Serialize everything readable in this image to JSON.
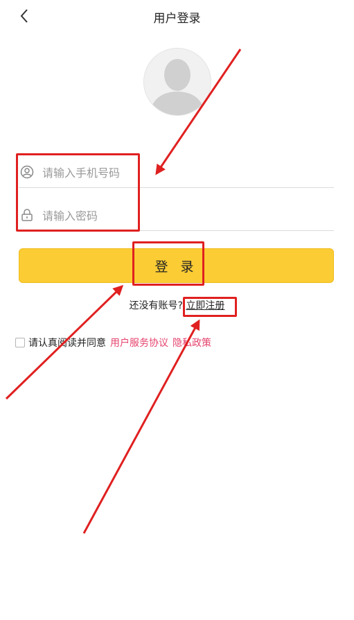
{
  "header": {
    "title": "用户登录",
    "back_icon": "chevron-left-icon"
  },
  "avatar": {
    "icon": "user-silhouette-icon"
  },
  "form": {
    "phone_placeholder": "请输入手机号码",
    "phone_value": "",
    "phone_icon": "user-circle-icon",
    "password_placeholder": "请输入密码",
    "password_value": "",
    "password_icon": "lock-icon"
  },
  "login_button": {
    "label": "登 录",
    "color": "#fbcc34"
  },
  "register": {
    "prompt": "还没有账号?",
    "link": "立即注册"
  },
  "agreement": {
    "checked": false,
    "text": "请认真阅读并同意",
    "terms_link": "用户服务协议",
    "privacy_link": "隐私政策",
    "link_color": "#e5436e"
  },
  "annotation": {
    "color": "#e02020"
  }
}
